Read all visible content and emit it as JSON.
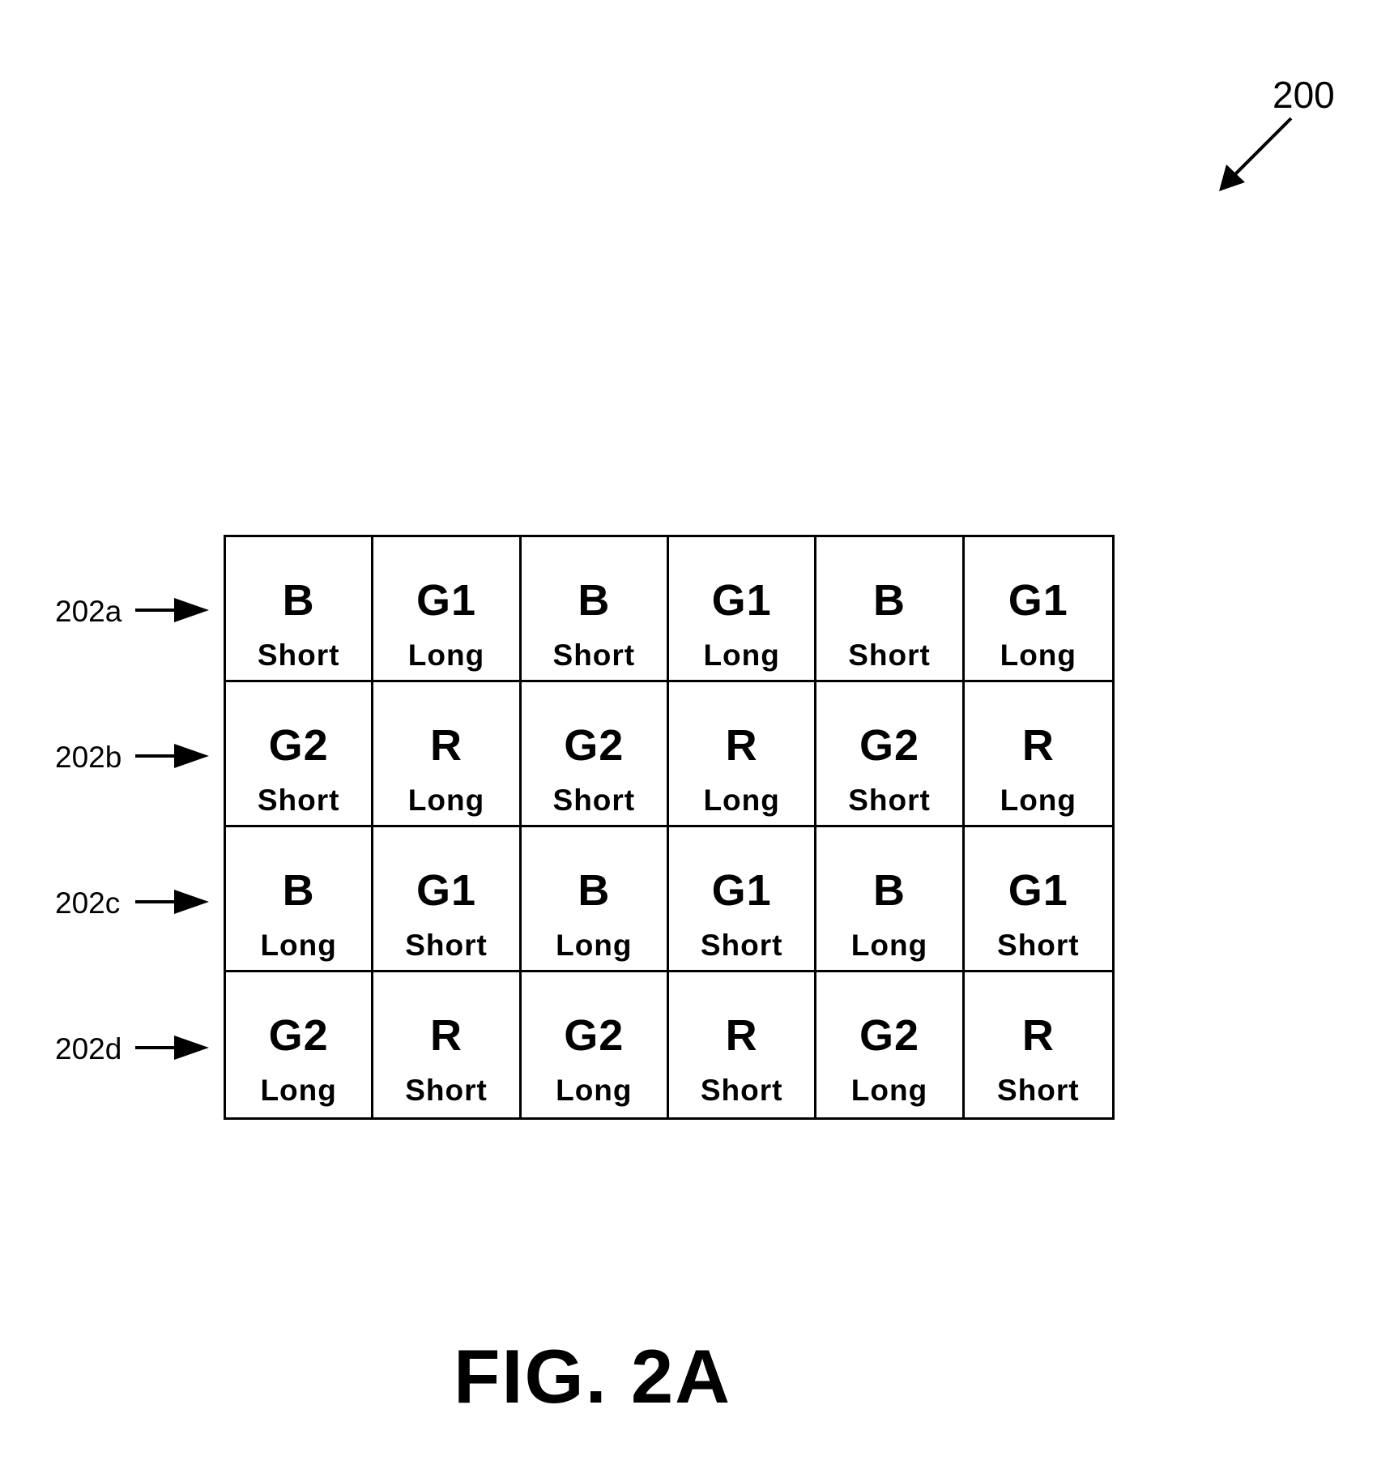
{
  "figure": {
    "reference_number": "200",
    "caption": "FIG. 2A"
  },
  "rows": [
    {
      "label": "202a",
      "cells": [
        {
          "channel": "B",
          "exposure": "Short"
        },
        {
          "channel": "G1",
          "exposure": "Long"
        },
        {
          "channel": "B",
          "exposure": "Short"
        },
        {
          "channel": "G1",
          "exposure": "Long"
        },
        {
          "channel": "B",
          "exposure": "Short"
        },
        {
          "channel": "G1",
          "exposure": "Long"
        }
      ]
    },
    {
      "label": "202b",
      "cells": [
        {
          "channel": "G2",
          "exposure": "Short"
        },
        {
          "channel": "R",
          "exposure": "Long"
        },
        {
          "channel": "G2",
          "exposure": "Short"
        },
        {
          "channel": "R",
          "exposure": "Long"
        },
        {
          "channel": "G2",
          "exposure": "Short"
        },
        {
          "channel": "R",
          "exposure": "Long"
        }
      ]
    },
    {
      "label": "202c",
      "cells": [
        {
          "channel": "B",
          "exposure": "Long"
        },
        {
          "channel": "G1",
          "exposure": "Short"
        },
        {
          "channel": "B",
          "exposure": "Long"
        },
        {
          "channel": "G1",
          "exposure": "Short"
        },
        {
          "channel": "B",
          "exposure": "Long"
        },
        {
          "channel": "G1",
          "exposure": "Short"
        }
      ]
    },
    {
      "label": "202d",
      "cells": [
        {
          "channel": "G2",
          "exposure": "Long"
        },
        {
          "channel": "R",
          "exposure": "Short"
        },
        {
          "channel": "G2",
          "exposure": "Long"
        },
        {
          "channel": "R",
          "exposure": "Short"
        },
        {
          "channel": "G2",
          "exposure": "Long"
        },
        {
          "channel": "R",
          "exposure": "Short"
        }
      ]
    }
  ],
  "colors": {
    "ink": "#000000",
    "background": "#ffffff"
  }
}
